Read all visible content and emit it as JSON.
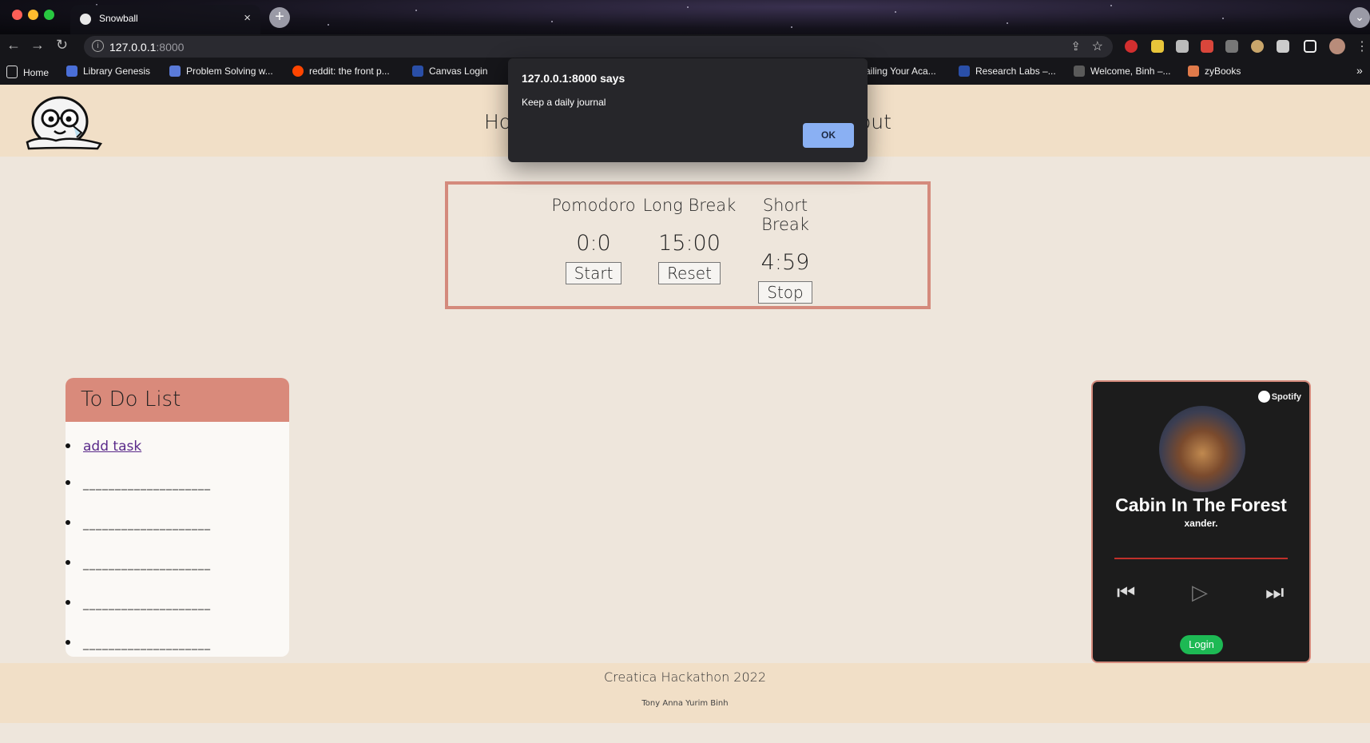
{
  "browser": {
    "tab_title": "Snowball",
    "tab_close": "×",
    "new_tab": "+",
    "url_host": "127.0.0.1",
    "url_port": ":8000",
    "bookmarks": [
      {
        "label": "Home",
        "color": "#16161a"
      },
      {
        "label": "Library Genesis",
        "color": "#4a6fd8"
      },
      {
        "label": "Problem Solving w...",
        "color": "#5a7ad8"
      },
      {
        "label": "reddit: the front p...",
        "color": "#ff4500"
      },
      {
        "label": "Canvas Login",
        "color": "#2a4fa8"
      },
      {
        "label": "ailing Your Aca...",
        "color": "#16161a"
      },
      {
        "label": "Research Labs –...",
        "color": "#2a4fa8"
      },
      {
        "label": "Welcome, Binh –...",
        "color": "#5a5a5a"
      },
      {
        "label": "zyBooks",
        "color": "#e07a4a"
      }
    ],
    "overflow": "»"
  },
  "header": {
    "nav_left": "Ho",
    "nav_right": "out"
  },
  "timer": {
    "columns": [
      {
        "label": "Pomodoro",
        "value": "0:0",
        "button": "Start"
      },
      {
        "label": "Long Break",
        "value": "15:00",
        "button": "Reset"
      },
      {
        "label": "Short Break",
        "value": "4:59",
        "button": "Stop"
      }
    ]
  },
  "todo": {
    "title": "To Do List",
    "add_task": "add task",
    "lines": [
      "____________________",
      "____________________",
      "____________________",
      "____________________",
      "____________________"
    ]
  },
  "spotify": {
    "brand": "Spotify",
    "track": "Cabin In The Forest",
    "artist": "xander.",
    "login": "Login",
    "progress_color": "#c0302b",
    "accent": "#1db954"
  },
  "footer": {
    "title": "Creatica Hackathon 2022",
    "names": "Tony Anna Yurim Binh"
  },
  "dialog": {
    "title": "127.0.0.1:8000 says",
    "message": "Keep a daily journal",
    "ok": "OK"
  }
}
